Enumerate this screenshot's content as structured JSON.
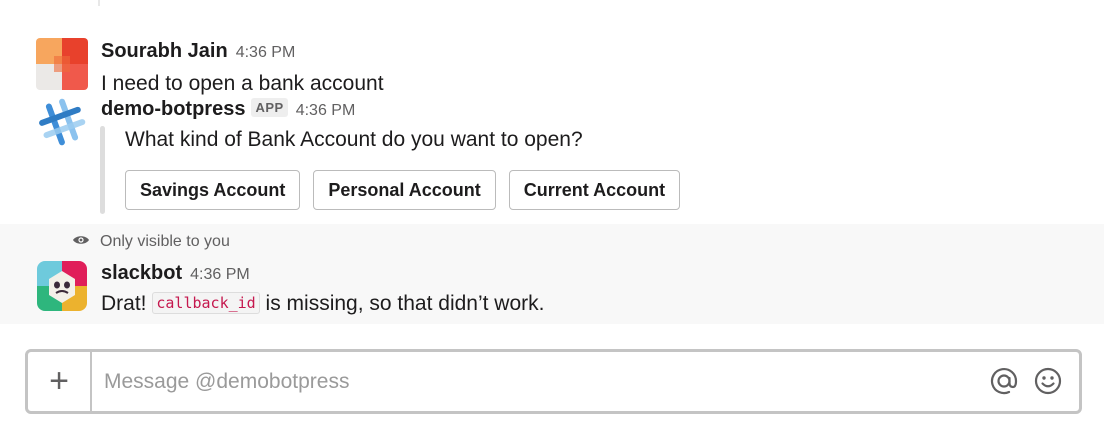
{
  "messages": [
    {
      "author": "Sourabh Jain",
      "time": "4:36 PM",
      "text": "I need to open a bank account"
    },
    {
      "author": "demo-botpress",
      "badge": "APP",
      "time": "4:36 PM",
      "attachment": {
        "text": "What kind of Bank Account do you want to open?",
        "buttons": [
          "Savings Account",
          "Personal Account",
          "Current Account"
        ]
      }
    }
  ],
  "ephemeral": {
    "note": "Only visible to you",
    "author": "slackbot",
    "time": "4:36 PM",
    "text_before": "Drat!",
    "code": "callback_id",
    "text_after": "is missing, so that didn’t work."
  },
  "composer": {
    "placeholder": "Message @demobotpress",
    "plus_label": "+"
  },
  "colors": {
    "code_text": "#c5184e",
    "border": "#c4c4c4"
  }
}
